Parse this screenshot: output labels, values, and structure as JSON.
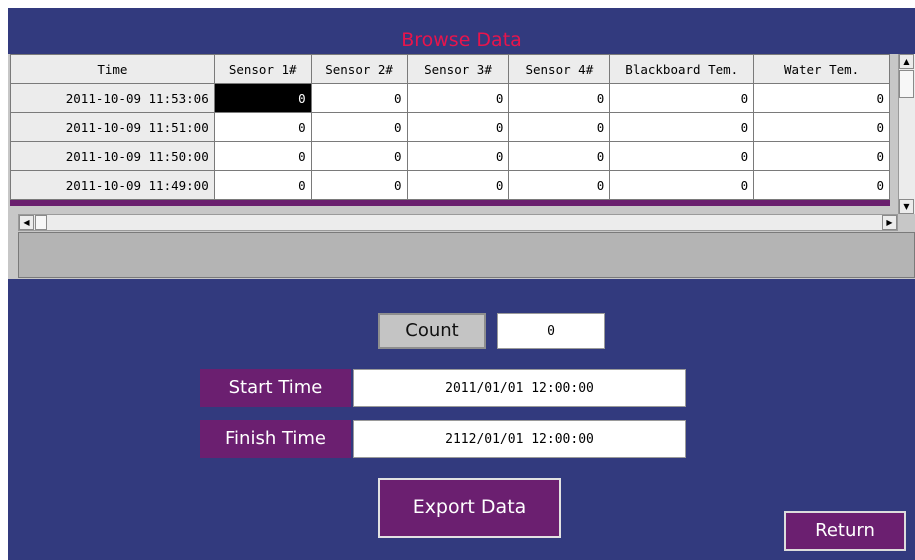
{
  "window": {
    "title": "Browse Data"
  },
  "table": {
    "columns": [
      "Time",
      "Sensor 1#",
      "Sensor 2#",
      "Sensor 3#",
      "Sensor 4#",
      "Blackboard Tem.",
      "Water Tem."
    ],
    "rows": [
      [
        "2011-10-09 11:53:06",
        "0",
        "0",
        "0",
        "0",
        "0",
        "0"
      ],
      [
        "2011-10-09 11:51:00",
        "0",
        "0",
        "0",
        "0",
        "0",
        "0"
      ],
      [
        "2011-10-09 11:50:00",
        "0",
        "0",
        "0",
        "0",
        "0",
        "0"
      ],
      [
        "2011-10-09 11:49:00",
        "0",
        "0",
        "0",
        "0",
        "0",
        "0"
      ]
    ],
    "selected_cell": {
      "row": 0,
      "col": 1
    }
  },
  "count": {
    "label": "Count",
    "value": "0"
  },
  "start_time": {
    "label": "Start Time",
    "value": "2011/01/01 12:00:00"
  },
  "finish_time": {
    "label": "Finish Time",
    "value": "2112/01/01 12:00:00"
  },
  "buttons": {
    "export": "Export Data",
    "return": "Return"
  },
  "icons": {
    "scroll_up": "arrow-up-icon",
    "scroll_down": "arrow-down-icon",
    "scroll_left": "arrow-left-icon",
    "scroll_right": "arrow-right-icon"
  },
  "colors": {
    "background": "#323a7e",
    "title": "#e8144c",
    "accent": "#6b1f70",
    "button_gray": "#c4c4c4"
  }
}
